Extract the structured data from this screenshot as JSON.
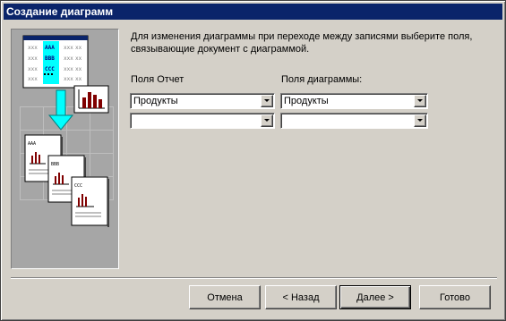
{
  "window": {
    "title": "Создание диаграмм"
  },
  "description": "Для изменения диаграммы при переходе между записями выберите поля, связывающие документ с диаграммой.",
  "report_fields": {
    "label": "Поля Отчет",
    "rows": [
      {
        "value": "Продукты"
      },
      {
        "value": ""
      }
    ]
  },
  "chart_fields": {
    "label": "Поля диаграммы:",
    "rows": [
      {
        "value": "Продукты"
      },
      {
        "value": ""
      }
    ]
  },
  "illustration": {
    "rows": [
      "AAA",
      "BBB",
      "CCC"
    ]
  },
  "buttons": {
    "cancel": "Отмена",
    "back": "< Назад",
    "next": "Далее >",
    "finish": "Готово"
  },
  "colors": {
    "titlebar": "#0a246a",
    "highlight": "#00ffff",
    "chart_bar": "#800000"
  }
}
